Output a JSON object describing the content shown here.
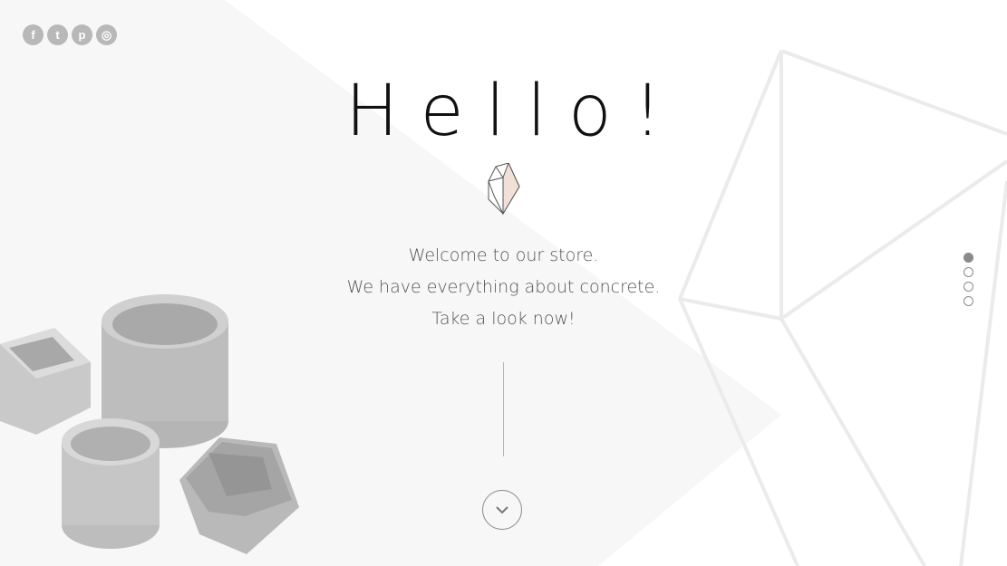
{
  "social": [
    {
      "icon": "facebook-icon",
      "glyph": "f"
    },
    {
      "icon": "twitter-icon",
      "glyph": "t"
    },
    {
      "icon": "pinterest-icon",
      "glyph": "p"
    },
    {
      "icon": "instagram-icon",
      "glyph": "◎"
    }
  ],
  "hero": {
    "title": "Hello!",
    "lines": [
      "Welcome to our store.",
      "We have everything about concrete.",
      "Take a look now!"
    ]
  },
  "pager": {
    "count": 4,
    "active_index": 0
  },
  "colors": {
    "text_dark": "#111111",
    "text_muted": "#555555",
    "icon_grey": "#b8b8b8",
    "gem_fill": "#f1e0d8"
  }
}
